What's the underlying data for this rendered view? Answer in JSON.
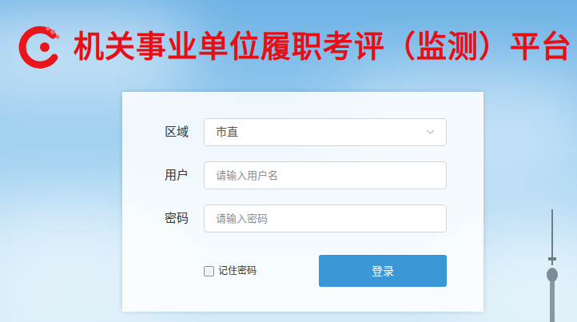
{
  "header": {
    "title": "机关事业单位履职考评（监测）平台"
  },
  "form": {
    "fields": [
      {
        "label": "区域",
        "kind": "select",
        "value": "市直"
      },
      {
        "label": "用户",
        "kind": "text",
        "placeholder": "请输入用户名"
      },
      {
        "label": "密码",
        "kind": "password",
        "placeholder": "请输入密码"
      }
    ],
    "remember": {
      "label": "记住密码",
      "checked": false
    },
    "submit": "登录"
  }
}
